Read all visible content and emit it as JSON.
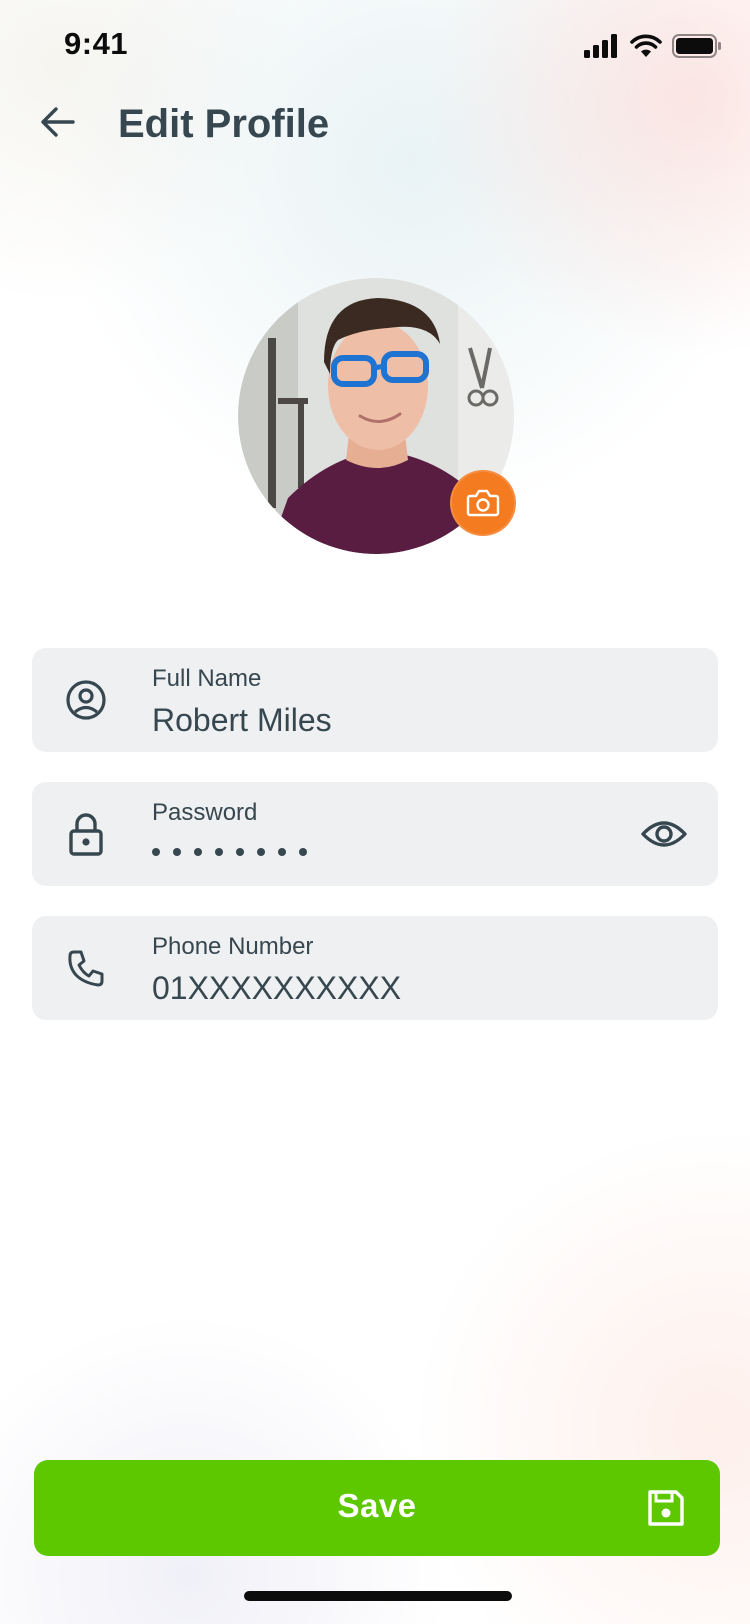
{
  "status_bar": {
    "time": "9:41",
    "icons": [
      "cellular-signal-icon",
      "wifi-icon",
      "battery-icon"
    ]
  },
  "header": {
    "title": "Edit Profile",
    "back_icon": "arrow-left-icon"
  },
  "profile": {
    "avatar_icon": "profile-photo",
    "camera_icon": "camera-icon"
  },
  "form": {
    "full_name": {
      "label": "Full Name",
      "value": "Robert Miles",
      "icon": "user-circle-icon"
    },
    "password": {
      "label": "Password",
      "icon": "lock-icon",
      "toggle_icon": "eye-icon"
    },
    "phone": {
      "label": "Phone Number",
      "value": "01XXXXXXXXXX",
      "icon": "phone-icon"
    }
  },
  "save": {
    "label": "Save",
    "icon": "floppy-disk-icon"
  },
  "colors": {
    "accent_green": "#5DC700",
    "camera_orange": "#F47B20",
    "text_dark": "#37474F",
    "field_bg": "#EFF0F2"
  }
}
